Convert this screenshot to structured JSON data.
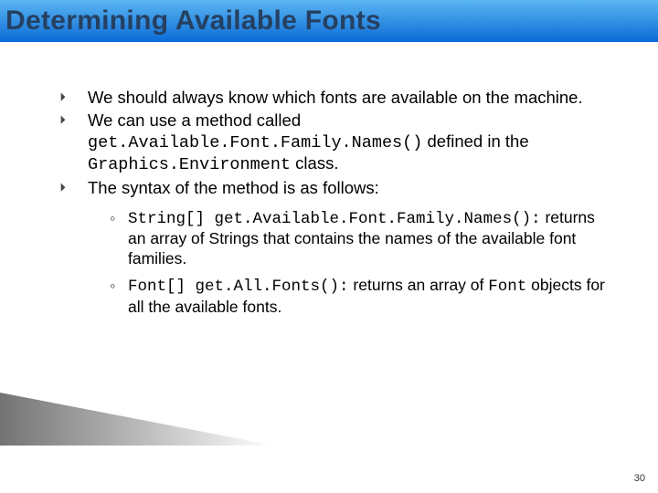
{
  "title": "Determining Available Fonts",
  "bullets": {
    "b0": {
      "text": "We should always know which fonts are available on the machine."
    },
    "b1": {
      "p0": "We can use a method called ",
      "code0": "get.Available.Font.Family.Names()",
      "p1": " defined in the ",
      "code1": "Graphics.Environment",
      "p2": " class."
    },
    "b2": {
      "text": "The syntax of the method is as follows:"
    }
  },
  "subs": {
    "s0": {
      "code": "String[] get.Available.Font.Family.Names():",
      "rest": " returns an array of Strings that contains the names of the available font families."
    },
    "s1": {
      "code0": "Font[] get.All.Fonts():",
      "mid": " returns an array of ",
      "code1": "Font",
      "rest": " objects for all the available fonts."
    }
  },
  "slide_number": "30"
}
